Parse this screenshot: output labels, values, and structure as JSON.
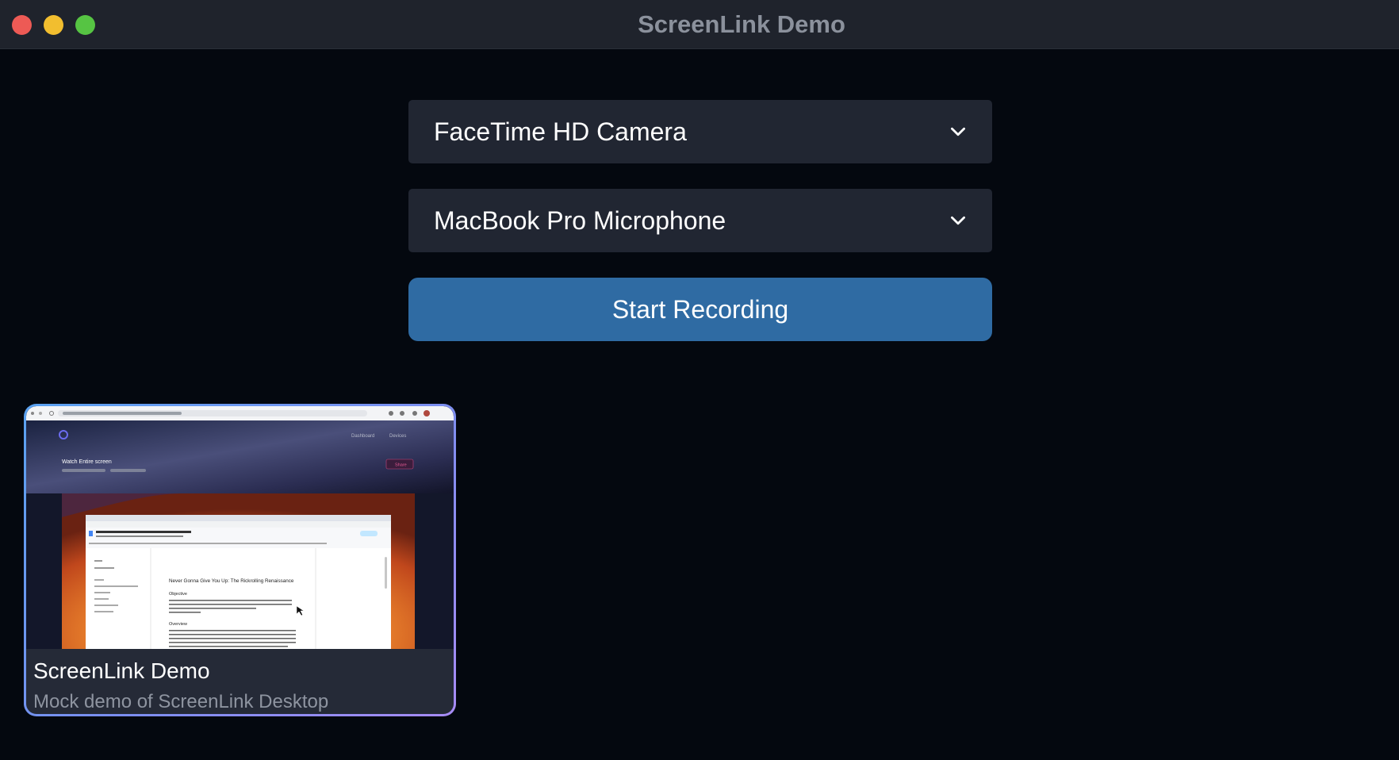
{
  "window": {
    "title": "ScreenLink Demo"
  },
  "camera_select": {
    "value": "FaceTime HD Camera",
    "icon": "chevron-down-icon"
  },
  "mic_select": {
    "value": "MacBook Pro Microphone",
    "icon": "chevron-down-icon"
  },
  "record_button": {
    "label": "Start Recording"
  },
  "recordings": [
    {
      "title": "ScreenLink Demo",
      "description": "Mock demo of ScreenLink Desktop",
      "thumbnail": {
        "nav_dashboard": "Dashboard",
        "nav_devices": "Devices",
        "video_title": "Watch Entire screen",
        "share_label": "Share",
        "doc_title": "Never Gonna Give You Up: The Rickrolling Renaissance",
        "doc_heading_1": "Objective",
        "doc_heading_2": "Overview"
      }
    }
  ],
  "colors": {
    "background": "#04080f",
    "titlebar": "#1f232c",
    "select_bg": "#212632",
    "accent": "#2f6ba3",
    "card_bg": "#252a37"
  }
}
